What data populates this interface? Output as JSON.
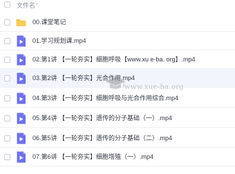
{
  "header": {
    "filename_label": "文件名",
    "sort_icon": "arrow-up-icon"
  },
  "colors": {
    "folder": "#f5c242",
    "video": "#6e72e6",
    "row_highlight": "#f2f6fc"
  },
  "files": [
    {
      "type": "folder",
      "name": "00.课堂笔记"
    },
    {
      "type": "video",
      "name": "01.学习规划课.mp4"
    },
    {
      "type": "video",
      "name": "02.第1讲 【一轮夯实】细胞呼吸【www.xu e-ba. org】.mp4"
    },
    {
      "type": "video",
      "name": "03.第2讲 【一轮夯实】光合作用.mp4"
    },
    {
      "type": "video",
      "name": "04.第3讲 【一轮夯实】细胞呼吸与光合作用综合.mp4"
    },
    {
      "type": "video",
      "name": "05.第4讲 【一轮夯实】遗传的分子基础（一）.mp4"
    },
    {
      "type": "video",
      "name": "06.第5讲 【一轮夯实】遗传的分子基础（二）.mp4"
    },
    {
      "type": "video",
      "name": "07.第6讲 【一轮夯实】细胞增殖（一）.mp4"
    }
  ],
  "watermark": {
    "text": "www.xue-ba.org"
  }
}
